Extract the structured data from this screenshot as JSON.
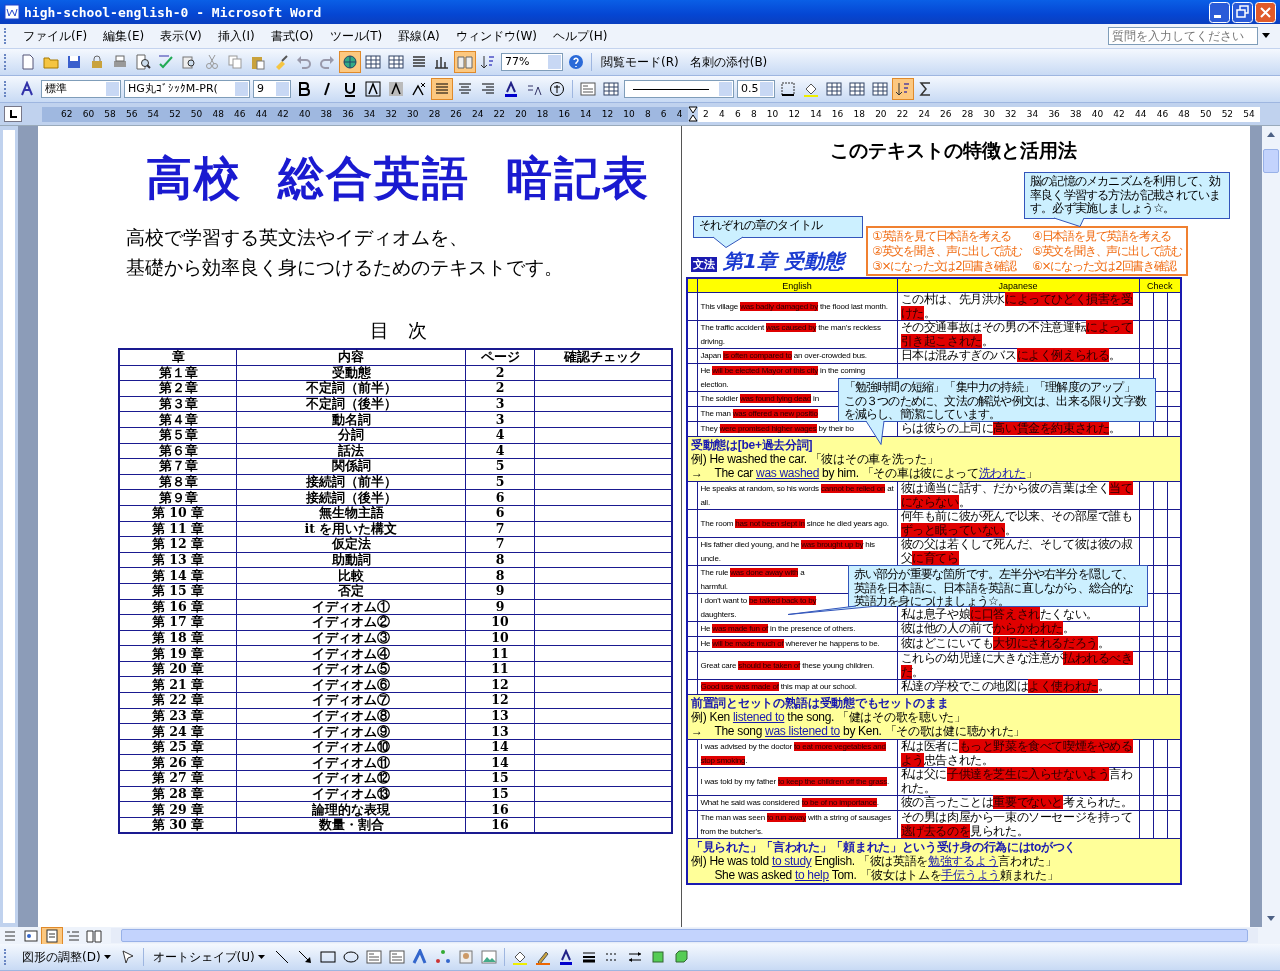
{
  "window": {
    "title": "high-school-english-0 - Microsoft Word"
  },
  "menu": [
    "ファイル(F)",
    "編集(E)",
    "表示(V)",
    "挿入(I)",
    "書式(O)",
    "ツール(T)",
    "罫線(A)",
    "ウィンドウ(W)",
    "ヘルプ(H)"
  ],
  "help_search": {
    "placeholder": "質問を入力してください"
  },
  "standard_toolbar": {
    "zoom": "77%",
    "buttons": [
      "閲覧モード(R)",
      "名刺の添付(B)"
    ]
  },
  "format_toolbar": {
    "style": "標準",
    "font": "HG丸ｺﾞｼｯｸM-PR(",
    "size": "9",
    "line_weight": "0.5"
  },
  "ruler": {
    "left_numbers": [
      "62",
      "60",
      "58",
      "56",
      "54",
      "52",
      "50",
      "48",
      "46",
      "44",
      "42",
      "40",
      "38",
      "36",
      "34",
      "32",
      "30",
      "28",
      "26",
      "24",
      "22",
      "20",
      "18",
      "16",
      "14",
      "12",
      "10",
      "8",
      "6",
      "4"
    ],
    "right_numbers": [
      "2",
      "4",
      "6",
      "8",
      "10",
      "12",
      "14",
      "16",
      "18",
      "20",
      "22",
      "24",
      "26",
      "28",
      "30",
      "32",
      "34",
      "36",
      "38",
      "40",
      "42",
      "44",
      "46",
      "48",
      "50",
      "52",
      "54"
    ]
  },
  "left_page": {
    "title": "高校  総合英語  暗記表",
    "subtitle": [
      "高校で学習する英文法やイディオムを、",
      "基礎から効率良く身につけるためのテキストです。"
    ],
    "toc_heading": "目　次",
    "toc": {
      "columns": [
        "章",
        "内容",
        "ページ",
        "確認チェック"
      ],
      "rows": [
        {
          "chapter": "第１章",
          "content": "受動態",
          "page": "2"
        },
        {
          "chapter": "第２章",
          "content": "不定詞（前半）",
          "page": "2"
        },
        {
          "chapter": "第３章",
          "content": "不定詞（後半）",
          "page": "3"
        },
        {
          "chapter": "第４章",
          "content": "動名詞",
          "page": "3"
        },
        {
          "chapter": "第５章",
          "content": "分詞",
          "page": "4"
        },
        {
          "chapter": "第６章",
          "content": "話法",
          "page": "4"
        },
        {
          "chapter": "第７章",
          "content": "関係詞",
          "page": "5"
        },
        {
          "chapter": "第８章",
          "content": "接続詞（前半）",
          "page": "5"
        },
        {
          "chapter": "第９章",
          "content": "接続詞（後半）",
          "page": "6"
        },
        {
          "chapter": "第 10 章",
          "content": "無生物主語",
          "page": "6"
        },
        {
          "chapter": "第 11 章",
          "content": "it を用いた構文",
          "page": "7"
        },
        {
          "chapter": "第 12 章",
          "content": "仮定法",
          "page": "7"
        },
        {
          "chapter": "第 13 章",
          "content": "助動詞",
          "page": "8"
        },
        {
          "chapter": "第 14 章",
          "content": "比較",
          "page": "8"
        },
        {
          "chapter": "第 15 章",
          "content": "否定",
          "page": "9"
        },
        {
          "chapter": "第 16 章",
          "content": "イディオム①",
          "page": "9"
        },
        {
          "chapter": "第 17 章",
          "content": "イディオム②",
          "page": "10"
        },
        {
          "chapter": "第 18 章",
          "content": "イディオム③",
          "page": "10"
        },
        {
          "chapter": "第 19 章",
          "content": "イディオム④",
          "page": "11"
        },
        {
          "chapter": "第 20 章",
          "content": "イディオム⑤",
          "page": "11"
        },
        {
          "chapter": "第 21 章",
          "content": "イディオム⑥",
          "page": "12"
        },
        {
          "chapter": "第 22 章",
          "content": "イディオム⑦",
          "page": "12"
        },
        {
          "chapter": "第 23 章",
          "content": "イディオム⑧",
          "page": "13"
        },
        {
          "chapter": "第 24 章",
          "content": "イディオム⑨",
          "page": "13"
        },
        {
          "chapter": "第 25 章",
          "content": "イディオム⑩",
          "page": "14"
        },
        {
          "chapter": "第 26 章",
          "content": "イディオム⑪",
          "page": "14"
        },
        {
          "chapter": "第 27 章",
          "content": "イディオム⑫",
          "page": "15"
        },
        {
          "chapter": "第 28 章",
          "content": "イディオム⑬",
          "page": "15"
        },
        {
          "chapter": "第 29 章",
          "content": "論理的な表現",
          "page": "16"
        },
        {
          "chapter": "第 30 章",
          "content": "数量・割合",
          "page": "16"
        }
      ]
    }
  },
  "right_page": {
    "heading": "このテキストの特徴と活用法",
    "section_label": "文法",
    "chapter_title": "第1章 受動態",
    "steps": [
      "①英語を見て日本語を考える",
      "④日本語を見て英語を考える",
      "②英文を聞き、声に出して読む",
      "⑤英文を聞き、声に出して読む",
      "③×になった文は2回書き確認",
      "⑥×になった文は2回書き確認"
    ],
    "callouts": [
      {
        "lines": [
          "それぞれの章のタイトル"
        ]
      },
      {
        "lines": [
          "脳の記憶のメカニズムを利用して、効率良く学習する方法が記載されています。必ず実施しましょう☆。"
        ]
      },
      {
        "lines": [
          "「勉強時間の短縮」「集中力の持続」「理解度のアップ」",
          "この３つのために、文法の解説や例文は、出来る限り文字数を減らし、簡潔にしています。"
        ]
      },
      {
        "lines": [
          "赤い部分が重要な箇所です。左半分や右半分を隠して、英語を日本語に、日本語を英語に直しながら、総合的な英語力を身につけましょう☆。"
        ]
      }
    ],
    "table": {
      "columns": [
        "English",
        "Japanese",
        "Check"
      ],
      "rows": [
        {
          "kind": "sentence",
          "english": [
            {
              "text": "This village ",
              "highlighted": false
            },
            {
              "text": "was badly damaged by",
              "highlighted": true
            },
            {
              "text": " the flood last month.",
              "highlighted": false
            }
          ],
          "japanese": [
            {
              "text": "この村は、先月洪水",
              "highlighted": false
            },
            {
              "text": "によってひどく損害を受けた",
              "highlighted": true
            },
            {
              "text": "。",
              "highlighted": false
            }
          ]
        },
        {
          "kind": "sentence",
          "english": [
            {
              "text": "The traffic accident ",
              "highlighted": false
            },
            {
              "text": "was caused by",
              "highlighted": true
            },
            {
              "text": " the man's reckless driving.",
              "highlighted": false
            }
          ],
          "japanese": [
            {
              "text": "その交通事故はその男の不注意運転",
              "highlighted": false
            },
            {
              "text": "によって引き起こされた",
              "highlighted": true
            },
            {
              "text": "。",
              "highlighted": false
            }
          ]
        },
        {
          "kind": "sentence",
          "english": [
            {
              "text": "Japan ",
              "highlighted": false
            },
            {
              "text": "is often compared to",
              "highlighted": true
            },
            {
              "text": " an over-crowded bus.",
              "highlighted": false
            }
          ],
          "japanese": [
            {
              "text": "日本は混みすぎのバス",
              "highlighted": false
            },
            {
              "text": "によく例えられる",
              "highlighted": true
            },
            {
              "text": "。",
              "highlighted": false
            }
          ]
        },
        {
          "kind": "sentence",
          "english": [
            {
              "text": "He ",
              "highlighted": false
            },
            {
              "text": "will be elected Mayor of this city",
              "highlighted": true
            },
            {
              "text": " in the coming\nelection.",
              "highlighted": false
            }
          ]
        },
        {
          "kind": "sentence",
          "english": [
            {
              "text": "The soldier ",
              "highlighted": false
            },
            {
              "text": "was found lying dead",
              "highlighted": true
            },
            {
              "text": " in",
              "highlighted": false
            }
          ]
        },
        {
          "kind": "sentence",
          "english": [
            {
              "text": "The man ",
              "highlighted": false
            },
            {
              "text": "was offered a new positio",
              "highlighted": true
            }
          ]
        },
        {
          "kind": "sentence",
          "english": [
            {
              "text": "They ",
              "highlighted": false
            },
            {
              "text": "were promised higher wages",
              "highlighted": true
            },
            {
              "text": " by their bo",
              "highlighted": false
            }
          ],
          "japanese": [
            {
              "text": "らは彼らの上司に",
              "highlighted": false
            },
            {
              "text": "高い賃金を約束された",
              "highlighted": true
            },
            {
              "text": "。",
              "highlighted": false
            }
          ]
        },
        {
          "kind": "note",
          "heading": "受動態は[be+過去分詞]",
          "lines": [
            [
              {
                "text": "例) He washed the car. 「彼はその車を洗った」",
                "underlined": false
              }
            ],
            [
              {
                "text": "→　The car ",
                "underlined": false
              },
              {
                "text": "was washed",
                "underlined": true
              },
              {
                "text": " by him. 「その車は彼によって",
                "underlined": false
              },
              {
                "text": "洗われた",
                "underlined": true
              },
              {
                "text": "」",
                "underlined": false
              }
            ]
          ]
        },
        {
          "kind": "sentence",
          "english": [
            {
              "text": "He speaks at random, so his words ",
              "highlighted": false
            },
            {
              "text": "cannot be relied on",
              "highlighted": true
            },
            {
              "text": " at all.",
              "highlighted": false
            }
          ],
          "japanese": [
            {
              "text": "彼は適当に話す、だから彼の言葉は全く",
              "highlighted": false
            },
            {
              "text": "当てにならない",
              "highlighted": true
            },
            {
              "text": "。",
              "highlighted": false
            }
          ]
        },
        {
          "kind": "sentence",
          "english": [
            {
              "text": "The room ",
              "highlighted": false
            },
            {
              "text": "has not been slept in",
              "highlighted": true
            },
            {
              "text": " since he died years ago.",
              "highlighted": false
            }
          ],
          "japanese": [
            {
              "text": "何年も前に彼が死んで以来、その部屋で誰も",
              "highlighted": false
            },
            {
              "text": "ずっと眠っていない",
              "highlighted": true
            },
            {
              "text": "。",
              "highlighted": false
            }
          ]
        },
        {
          "kind": "sentence",
          "english": [
            {
              "text": "His father died young, and he ",
              "highlighted": false
            },
            {
              "text": "was brought up by",
              "highlighted": true
            },
            {
              "text": " his uncle.",
              "highlighted": false
            }
          ],
          "japanese": [
            {
              "text": "彼の父は若くして死んだ、そして彼は彼の叔父",
              "highlighted": false
            },
            {
              "text": "に育てら",
              "highlighted": true
            }
          ]
        },
        {
          "kind": "sentence",
          "english": [
            {
              "text": "The rule ",
              "highlighted": false
            },
            {
              "text": "was done away with",
              "highlighted": true
            },
            {
              "text": " a\nharmful.",
              "highlighted": false
            }
          ]
        },
        {
          "kind": "sentence",
          "english": [
            {
              "text": "I don't want to ",
              "highlighted": false
            },
            {
              "text": "be talked back to by",
              "highlighted": true
            },
            {
              "text": "\ndaughters.",
              "highlighted": false
            }
          ],
          "japanese": [
            {
              "text": "私は息子や娘",
              "highlighted": false
            },
            {
              "text": "に口答えされ",
              "highlighted": true
            },
            {
              "text": "たくない。",
              "highlighted": false
            }
          ]
        },
        {
          "kind": "sentence",
          "english": [
            {
              "text": "He ",
              "highlighted": false
            },
            {
              "text": "was made fun of",
              "highlighted": true
            },
            {
              "text": " in the presence of others.",
              "highlighted": false
            }
          ],
          "japanese": [
            {
              "text": "彼は他の人の前で",
              "highlighted": false
            },
            {
              "text": "からかわれた",
              "highlighted": true
            },
            {
              "text": "。",
              "highlighted": false
            }
          ]
        },
        {
          "kind": "sentence",
          "english": [
            {
              "text": "He ",
              "highlighted": false
            },
            {
              "text": "will be made much of",
              "highlighted": true
            },
            {
              "text": " wherever he happens to be.",
              "highlighted": false
            }
          ],
          "japanese": [
            {
              "text": "彼はどこにいても",
              "highlighted": false
            },
            {
              "text": "大切にされるだろう",
              "highlighted": true
            },
            {
              "text": "。",
              "highlighted": false
            }
          ]
        },
        {
          "kind": "sentence",
          "english": [
            {
              "text": "Great care ",
              "highlighted": false
            },
            {
              "text": "should be taken of",
              "highlighted": true
            },
            {
              "text": " these young children.",
              "highlighted": false
            }
          ],
          "japanese": [
            {
              "text": "これらの幼児達に大きな注意が",
              "highlighted": false
            },
            {
              "text": "払われるべきだ",
              "highlighted": true
            },
            {
              "text": "。",
              "highlighted": false
            }
          ]
        },
        {
          "kind": "sentence",
          "english": [
            {
              "text": "Good use was made of",
              "highlighted": true
            },
            {
              "text": " this map at our school.",
              "highlighted": false
            }
          ],
          "japanese": [
            {
              "text": "私達の学校でこの地図は",
              "highlighted": false
            },
            {
              "text": "よく使われた",
              "highlighted": true
            },
            {
              "text": "。",
              "highlighted": false
            }
          ]
        },
        {
          "kind": "note",
          "heading": "前置詞とセットの熟語は受動態でもセットのまま",
          "lines": [
            [
              {
                "text": "例) Ken ",
                "underlined": false
              },
              {
                "text": "listened to",
                "underlined": true
              },
              {
                "text": " the song. 「健はその歌を聴いた」",
                "underlined": false
              }
            ],
            [
              {
                "text": "→　The song ",
                "underlined": false
              },
              {
                "text": "was listened to",
                "underlined": true
              },
              {
                "text": " by Ken. 「その歌は健に聴かれた」",
                "underlined": false
              }
            ]
          ]
        },
        {
          "kind": "sentence",
          "english": [
            {
              "text": "I was advised by the doctor ",
              "highlighted": false
            },
            {
              "text": "to eat more vegetables and stop smoking",
              "highlighted": true
            },
            {
              "text": ".",
              "highlighted": false
            }
          ],
          "japanese": [
            {
              "text": "私は医者に",
              "highlighted": false
            },
            {
              "text": "もっと野菜を食べて喫煙をやめるよう",
              "highlighted": true
            },
            {
              "text": "忠告された。",
              "highlighted": false
            }
          ]
        },
        {
          "kind": "sentence",
          "english": [
            {
              "text": "I was told by my father ",
              "highlighted": false
            },
            {
              "text": "to keep the children off the grass",
              "highlighted": true
            },
            {
              "text": ".",
              "highlighted": false
            }
          ],
          "japanese": [
            {
              "text": "私は父に",
              "highlighted": false
            },
            {
              "text": "子供達を芝生に入らせないよう",
              "highlighted": true
            },
            {
              "text": "言われた。",
              "highlighted": false
            }
          ]
        },
        {
          "kind": "sentence",
          "english": [
            {
              "text": "What he said was considered ",
              "highlighted": false
            },
            {
              "text": "to be of no importance",
              "highlighted": true
            },
            {
              "text": ".",
              "highlighted": false
            }
          ],
          "japanese": [
            {
              "text": "彼の言ったことは",
              "highlighted": false
            },
            {
              "text": "重要でないと",
              "highlighted": true
            },
            {
              "text": "考えられた。",
              "highlighted": false
            }
          ]
        },
        {
          "kind": "sentence",
          "english": [
            {
              "text": "The man was seen ",
              "highlighted": false
            },
            {
              "text": "to run away",
              "highlighted": true
            },
            {
              "text": " with a string of sausages from the butcher's.",
              "highlighted": false
            }
          ],
          "japanese": [
            {
              "text": "その男は肉屋から一束のソーセージを持って",
              "highlighted": false
            },
            {
              "text": "逃げ去るのを",
              "highlighted": true
            },
            {
              "text": "見られた。",
              "highlighted": false
            }
          ]
        },
        {
          "kind": "note",
          "heading": "「見られた」「言われた」「頼まれた」という受け身の行為にはtoがつく",
          "lines": [
            [
              {
                "text": "例) He was told ",
                "underlined": false
              },
              {
                "text": "to study",
                "underlined": true
              },
              {
                "text": " English. 「彼は英語を",
                "underlined": false
              },
              {
                "text": "勉強するよう",
                "underlined": true
              },
              {
                "text": "言われた」",
                "underlined": false
              }
            ],
            [
              {
                "text": "　　She was asked ",
                "underlined": false
              },
              {
                "text": "to help",
                "underlined": true
              },
              {
                "text": " Tom. 「彼女はトムを",
                "underlined": false
              },
              {
                "text": "手伝うよう",
                "underlined": true
              },
              {
                "text": "頼まれた」",
                "underlined": false
              }
            ]
          ]
        }
      ]
    }
  },
  "drawing_toolbar": {
    "menus": [
      "図形の調整(D)",
      "オートシェイプ(U)"
    ]
  }
}
